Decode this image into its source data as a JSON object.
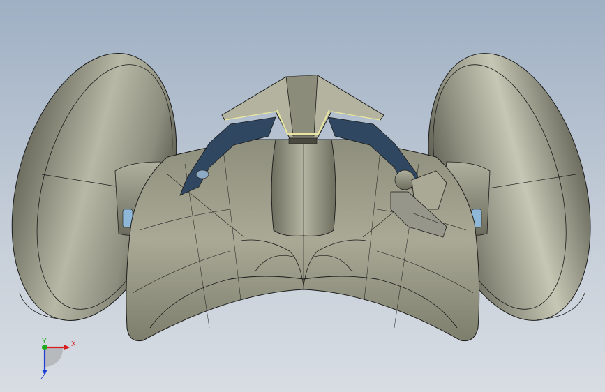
{
  "viewport": {
    "background_top": "#9fb0c4",
    "background_bottom": "#d8dde3"
  },
  "model": {
    "body_color": "#9a9a86",
    "wheel_color": "#a3a392",
    "bracket_color": "#2f4760",
    "highlight_color": "#e8e6a0",
    "edge_color": "#1c1c1c"
  },
  "triad": {
    "x_label": "X",
    "y_label": "Y",
    "z_label": "Z",
    "x_color": "#d62020",
    "y_color": "#1faa1f",
    "z_color": "#1f3fd6"
  }
}
